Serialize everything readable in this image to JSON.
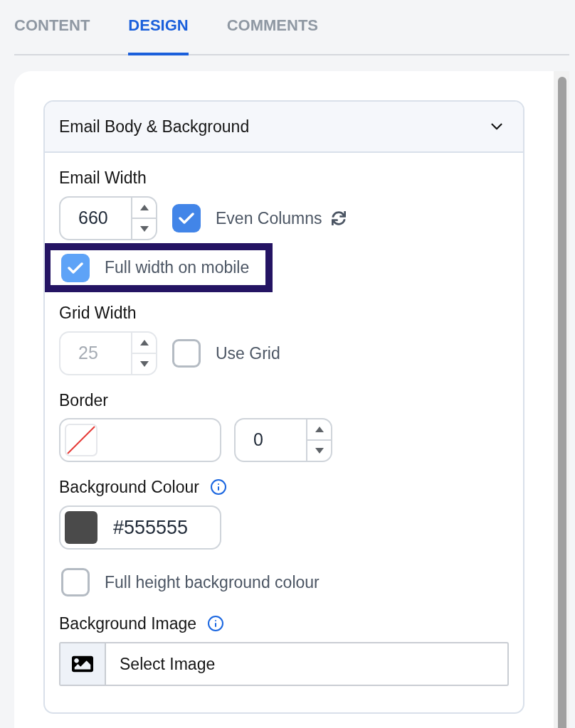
{
  "tabs": [
    {
      "label": "CONTENT",
      "selected": false
    },
    {
      "label": "DESIGN",
      "selected": true
    },
    {
      "label": "COMMENTS",
      "selected": false
    }
  ],
  "section": {
    "title": "Email Body & Background",
    "expanded": true,
    "fields": [
      {
        "kind": "spinner_group",
        "label": "Email Width",
        "spinner": {
          "value": "660",
          "disabled": false
        },
        "option": {
          "kind": "refresh",
          "label": "Even Columns",
          "checked": true
        }
      },
      {
        "kind": "option",
        "label": "Full width on mobile",
        "checked": true,
        "highlighted": true
      },
      {
        "kind": "spinner_group",
        "label": "Grid Width",
        "spinner": {
          "value": "25",
          "disabled": true
        },
        "option": {
          "kind": "plain",
          "label": "Use Grid",
          "checked": false
        }
      },
      {
        "kind": "border",
        "label": "Border",
        "spinner": {
          "value": "0",
          "disabled": false
        }
      },
      {
        "kind": "colour",
        "label": "Background Colour",
        "info": true,
        "value": "#555555",
        "color": "#4a4a4a"
      },
      {
        "kind": "option",
        "label": "Full height background colour",
        "checked": false,
        "highlighted": false
      },
      {
        "kind": "image",
        "label": "Background Image",
        "info": true,
        "button": "Select Image"
      }
    ]
  }
}
